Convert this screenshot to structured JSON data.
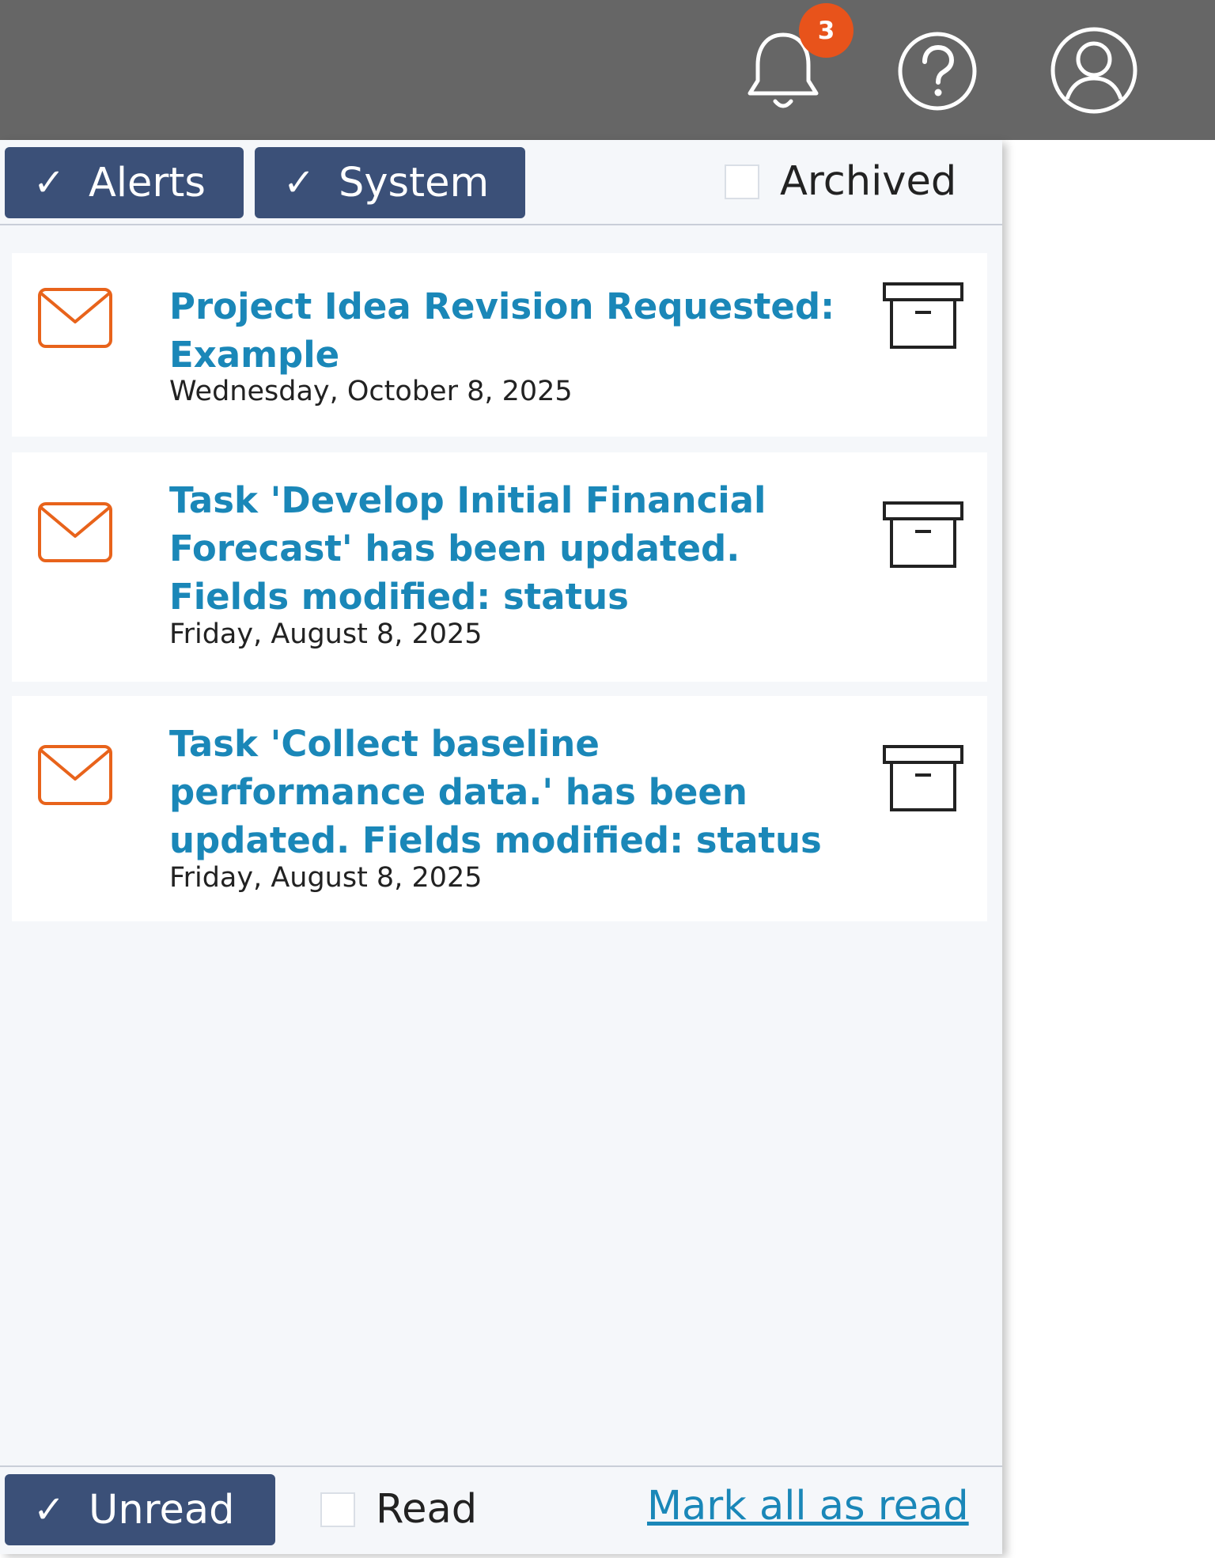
{
  "header": {
    "notification_count": "3",
    "icons": [
      "bell-icon",
      "help-icon",
      "account-icon"
    ]
  },
  "filters": {
    "alerts": {
      "label": "Alerts",
      "checked": true
    },
    "system": {
      "label": "System",
      "checked": true
    },
    "archived": {
      "label": "Archived",
      "checked": false
    }
  },
  "notifications": [
    {
      "title": "Project Idea Revision Requested: Example",
      "date": "Wednesday, October 8, 2025",
      "icon": "envelope-icon"
    },
    {
      "title": "Task 'Develop Initial Financial Forecast' has been updated. Fields modified: status",
      "date": "Friday, August 8, 2025",
      "icon": "envelope-icon"
    },
    {
      "title": "Task 'Collect baseline performance data.' has been updated. Fields modified: status",
      "date": "Friday, August 8, 2025",
      "icon": "envelope-icon"
    }
  ],
  "footer": {
    "unread": {
      "label": "Unread",
      "checked": true
    },
    "read": {
      "label": "Read",
      "checked": false
    },
    "mark_all_label": "Mark all as read"
  },
  "colors": {
    "topbar": "#666666",
    "badge": "#e8531b",
    "chip": "#3b5078",
    "link": "#1a87b8",
    "envelope": "#e8631b",
    "panel": "#f5f7fa"
  }
}
